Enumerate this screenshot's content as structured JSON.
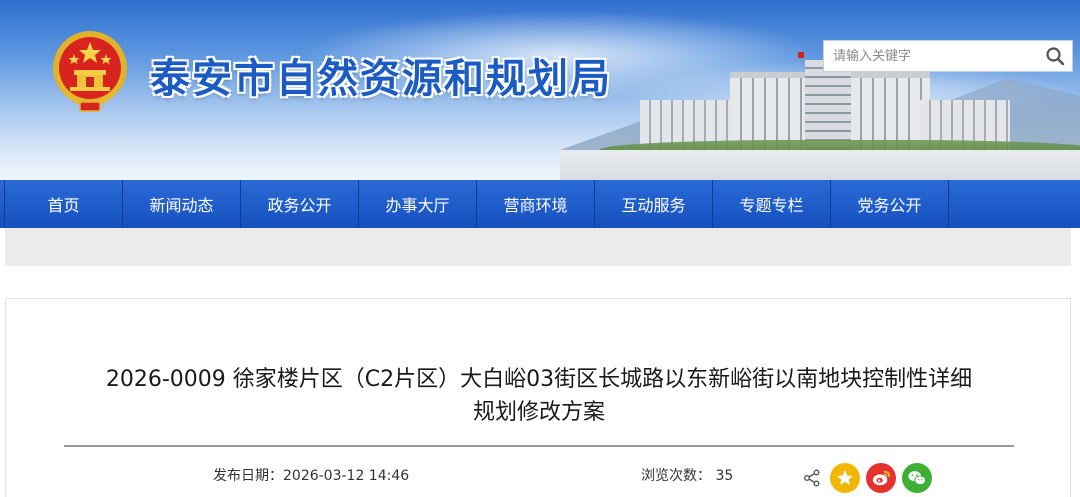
{
  "header": {
    "site_title": "泰安市自然资源和规划局",
    "search_placeholder": "请输入关键字"
  },
  "nav": {
    "items": [
      {
        "label": "首页"
      },
      {
        "label": "新闻动态"
      },
      {
        "label": "政务公开"
      },
      {
        "label": "办事大厅"
      },
      {
        "label": "营商环境"
      },
      {
        "label": "互动服务"
      },
      {
        "label": "专题专栏"
      },
      {
        "label": "党务公开"
      }
    ]
  },
  "article": {
    "title_line1": "2026-0009 徐家楼片区（C2片区）大白峪03街区长城路以东新峪街以南地块控制性详细",
    "title_line2": "规划修改方案",
    "publish_label": "发布日期：",
    "publish_date": "2026-03-12 14:46",
    "views_label": "浏览次数：",
    "views_count": "35"
  },
  "share": {
    "icons": [
      "share-icon",
      "star-icon",
      "weibo-icon",
      "wechat-icon"
    ]
  },
  "colors": {
    "nav_bg": "#1c5ac7",
    "title_blue": "#1d5bc4",
    "star": "#f2b705",
    "weibo": "#e6322d",
    "wechat": "#3cb034"
  }
}
